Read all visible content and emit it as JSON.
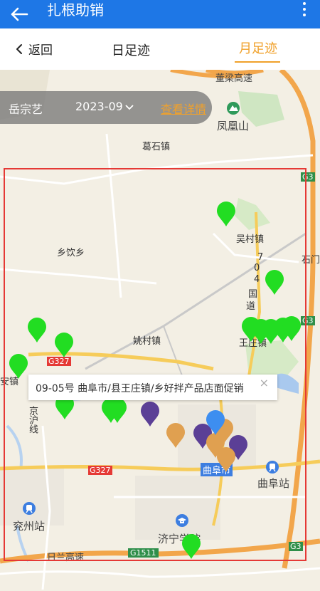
{
  "appbar": {
    "title": "扎根助销",
    "back_icon": "arrow-left-icon",
    "more_icon": "more-vertical-icon"
  },
  "tabs": {
    "return_label": "返回",
    "day_label": "日足迹",
    "month_label": "月足迹",
    "active_color": "#f0a12b"
  },
  "filter": {
    "person": "岳宗艺",
    "month": "2023-09",
    "detail_link": "查看详情"
  },
  "map": {
    "labels": {
      "expressway_top": "董梁高速",
      "fenghuang": "凤凰山",
      "geshi": "葛石镇",
      "wucun": "吴村镇",
      "xiangyin": "乡饮乡",
      "guodao_7": "7",
      "guodao_0": "0",
      "guodao_4": "4",
      "guodao_guo": "国",
      "guodao_dao": "道",
      "shimen": "石门",
      "yaocun": "姚村镇",
      "wangzhuang": "王庄镇",
      "g327_a": "G327",
      "g327_b": "G327",
      "anzhen": "安镇",
      "jinghuxian": "京沪线",
      "qufu_city": "曲阜市",
      "qufu_station": "曲阜站",
      "yanzhou_station": "兖州站",
      "jining_college": "济宁学院",
      "rilan": "日兰高速",
      "g1511": "G1511",
      "g3_top": "G3",
      "g3_mid": "G3",
      "g3_bottom": "G3"
    },
    "popup": {
      "text": "09-05号  曲阜市/县王庄镇/乡好拌产品店面促销",
      "close": "×"
    },
    "pin_colors": {
      "green": "#22dd22",
      "purple": "#5b3f96",
      "orange": "#e0a050",
      "blue": "#3d8ef0"
    }
  }
}
